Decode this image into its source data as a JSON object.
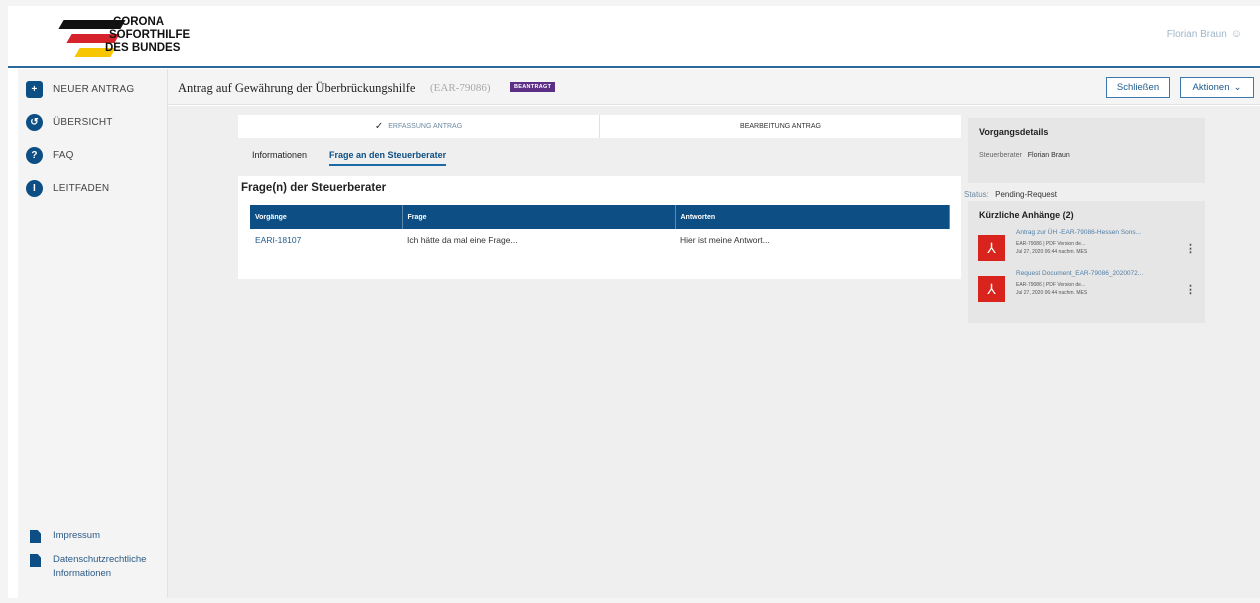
{
  "brand": {
    "line1": "CORONA",
    "line2": "SOFORTHILFE",
    "line3": "DES BUNDES",
    "colors": {
      "black": "#111111",
      "red": "#d6232b",
      "gold": "#f7c600",
      "primary": "#0d4f84"
    }
  },
  "header": {
    "user_name": "Florian Braun",
    "user_icon": "person-icon"
  },
  "sidebar": {
    "items": [
      {
        "label": "NEUER ANTRAG",
        "icon": "plus-document-icon",
        "glyph": "+"
      },
      {
        "label": "ÜBERSICHT",
        "icon": "history-icon",
        "glyph": "↺"
      },
      {
        "label": "FAQ",
        "icon": "question-icon",
        "glyph": "?"
      },
      {
        "label": "LEITFADEN",
        "icon": "info-icon",
        "glyph": "i"
      }
    ],
    "footer": [
      {
        "label": "Impressum",
        "icon": "document-icon"
      },
      {
        "label": "Datenschutzrechtliche Informationen",
        "icon": "document-icon"
      }
    ]
  },
  "titlebar": {
    "title": "Antrag auf Gewährung der Überbrückungshilfe",
    "ref": "(EAR-79086)",
    "badge": "BEANTRAGT",
    "close_label": "Schließen",
    "actions_label": "Aktionen",
    "actions_icon": "chevron-down-icon"
  },
  "stepper": {
    "steps": [
      {
        "label": "ERFASSUNG ANTRAG",
        "done": true
      },
      {
        "label": "BEARBEITUNG ANTRAG",
        "done": false
      }
    ]
  },
  "tabs": [
    {
      "label": "Informationen",
      "active": false
    },
    {
      "label": "Frage an den Steuerberater",
      "active": true
    }
  ],
  "questions": {
    "title": "Frage(n) der Steuerberater",
    "columns": [
      "Vorgänge",
      "Frage",
      "Antworten"
    ],
    "rows": [
      {
        "ref": "EARI-18107",
        "question": "Ich hätte da mal eine Frage...",
        "answer": "Hier ist meine Antwort..."
      }
    ]
  },
  "details": {
    "title": "Vorgangsdetails",
    "advisor_label": "Steuerberater",
    "advisor_value": "Florian Braun",
    "status_label": "Status:",
    "status_value": "Pending-Request"
  },
  "attachments": {
    "title": "Kürzliche Anhänge (2)",
    "items": [
      {
        "name": "Antrag zur ÜH -EAR-79086-Hessen Sons...",
        "meta1": "EAR-79086 | PDF Version de...",
        "meta2": "Jul 27, 2020 06:44 nachm. MES",
        "icon": "pdf-icon"
      },
      {
        "name": "Request Document_EAR-79086_2020072...",
        "meta1": "EAR-79086 | PDF Version de...",
        "meta2": "Jul 27, 2020 06:44 nachm. MES",
        "icon": "pdf-icon"
      }
    ]
  }
}
